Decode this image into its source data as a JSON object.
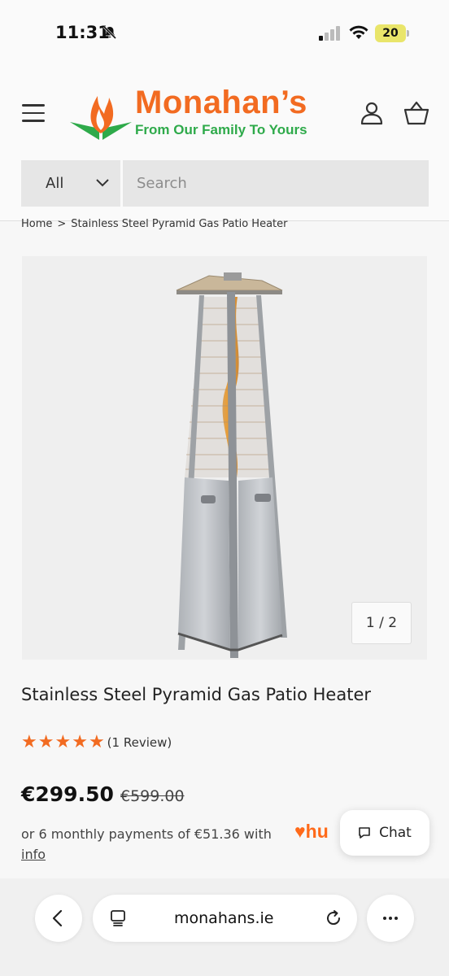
{
  "status_bar": {
    "time": "11:31",
    "battery": "20"
  },
  "header": {
    "logo_name": "Monahan’s",
    "logo_tagline": "From Our Family To Yours",
    "colors": {
      "brand_orange": "#f26b21",
      "brand_green": "#2eaa4a"
    }
  },
  "search": {
    "category": "All",
    "placeholder": "Search"
  },
  "breadcrumb": {
    "home": "Home",
    "current": "Stainless Steel Pyramid Gas Patio Heater"
  },
  "gallery": {
    "counter": "1 / 2"
  },
  "product": {
    "title": "Stainless Steel Pyramid Gas Patio Heater",
    "rating": 5,
    "rating_max": 5,
    "review_text": "(1 Review)",
    "price": "€299.50",
    "price_was": "€599.00",
    "installment_text": "or 6 monthly payments of €51.36 with",
    "humm_logo": "hu",
    "info_link": "info"
  },
  "chat": {
    "label": "Chat"
  },
  "browser": {
    "url": "monahans.ie"
  }
}
